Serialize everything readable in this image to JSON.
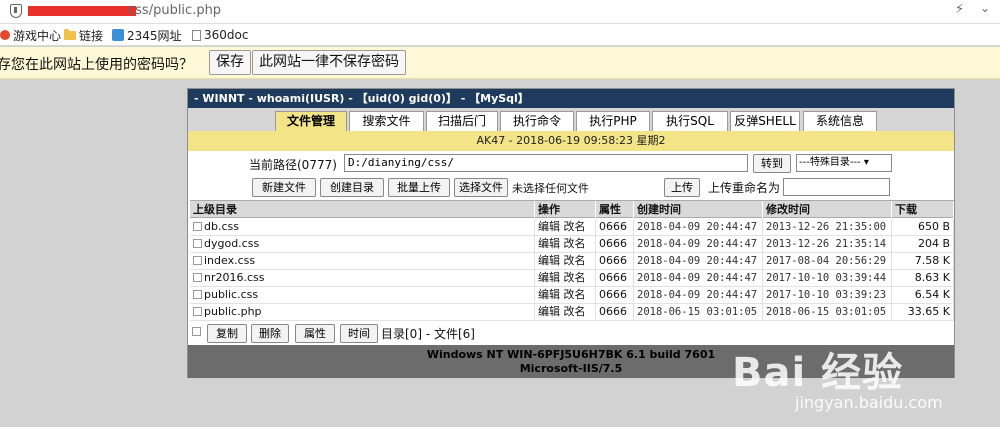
{
  "browser": {
    "url_visible": "css/public.php",
    "bookmarks": [
      {
        "label": "游戏中心",
        "icon": "game-icon"
      },
      {
        "label": "链接",
        "icon": "folder-icon"
      },
      {
        "label": "2345网址",
        "icon": "site-icon"
      },
      {
        "label": "360doc",
        "icon": "page-icon"
      }
    ]
  },
  "password_bar": {
    "message": "存您在此网站上使用的密码吗？",
    "save": "保存",
    "never": "此网站一律不保存密码"
  },
  "shell": {
    "title": "- WINNT - whoami(IUSR) - 【uid(0) gid(0)】 - 【MySql】",
    "tabs": [
      "文件管理",
      "搜索文件",
      "扫描后门",
      "执行命令",
      "执行PHP",
      "执行SQL",
      "反弹SHELL",
      "系统信息"
    ],
    "info": "AK47 - 2018-06-19 09:58:23 星期2",
    "path_label": "当前路径(0777)",
    "path_value": "D:/dianying/css/",
    "goto": "转到",
    "special_dir": "---特殊目录---",
    "toolbar": {
      "new_file": "新建文件",
      "new_dir": "创建目录",
      "batch_upload": "批量上传",
      "choose_file": "选择文件",
      "no_file": "未选择任何文件",
      "upload": "上传",
      "rename_label": "上传重命名为"
    },
    "table": {
      "headers": [
        "上级目录",
        "操作",
        "属性",
        "创建时间",
        "修改时间",
        "下载"
      ],
      "rows": [
        {
          "name": "db.css",
          "ops": "编辑 改名",
          "attr": "0666",
          "created": "2018-04-09 20:44:47",
          "modified": "2013-12-26 21:35:00",
          "size": "650 B"
        },
        {
          "name": "dygod.css",
          "ops": "编辑 改名",
          "attr": "0666",
          "created": "2018-04-09 20:44:47",
          "modified": "2013-12-26 21:35:14",
          "size": "204 B"
        },
        {
          "name": "index.css",
          "ops": "编辑 改名",
          "attr": "0666",
          "created": "2018-04-09 20:44:47",
          "modified": "2017-08-04 20:56:29",
          "size": "7.58 K"
        },
        {
          "name": "nr2016.css",
          "ops": "编辑 改名",
          "attr": "0666",
          "created": "2018-04-09 20:44:47",
          "modified": "2017-10-10 03:39:44",
          "size": "8.63 K"
        },
        {
          "name": "public.css",
          "ops": "编辑 改名",
          "attr": "0666",
          "created": "2018-04-09 20:44:47",
          "modified": "2017-10-10 03:39:23",
          "size": "6.54 K"
        },
        {
          "name": "public.php",
          "ops": "编辑 改名",
          "attr": "0666",
          "created": "2018-06-15 03:01:05",
          "modified": "2018-06-15 03:01:05",
          "size": "33.65 K"
        }
      ]
    },
    "footer": {
      "copy": "复制",
      "delete": "删除",
      "attr": "属性",
      "time": "时间",
      "summary": "目录[0] - 文件[6]"
    },
    "status_line1": "Windows NT WIN-6PFJ5U6H7BK 6.1 build 7601",
    "status_line2": "Microsoft-IIS/7.5"
  },
  "watermark": {
    "logo": "Bai 经验",
    "url": "jingyan.baidu.com"
  }
}
